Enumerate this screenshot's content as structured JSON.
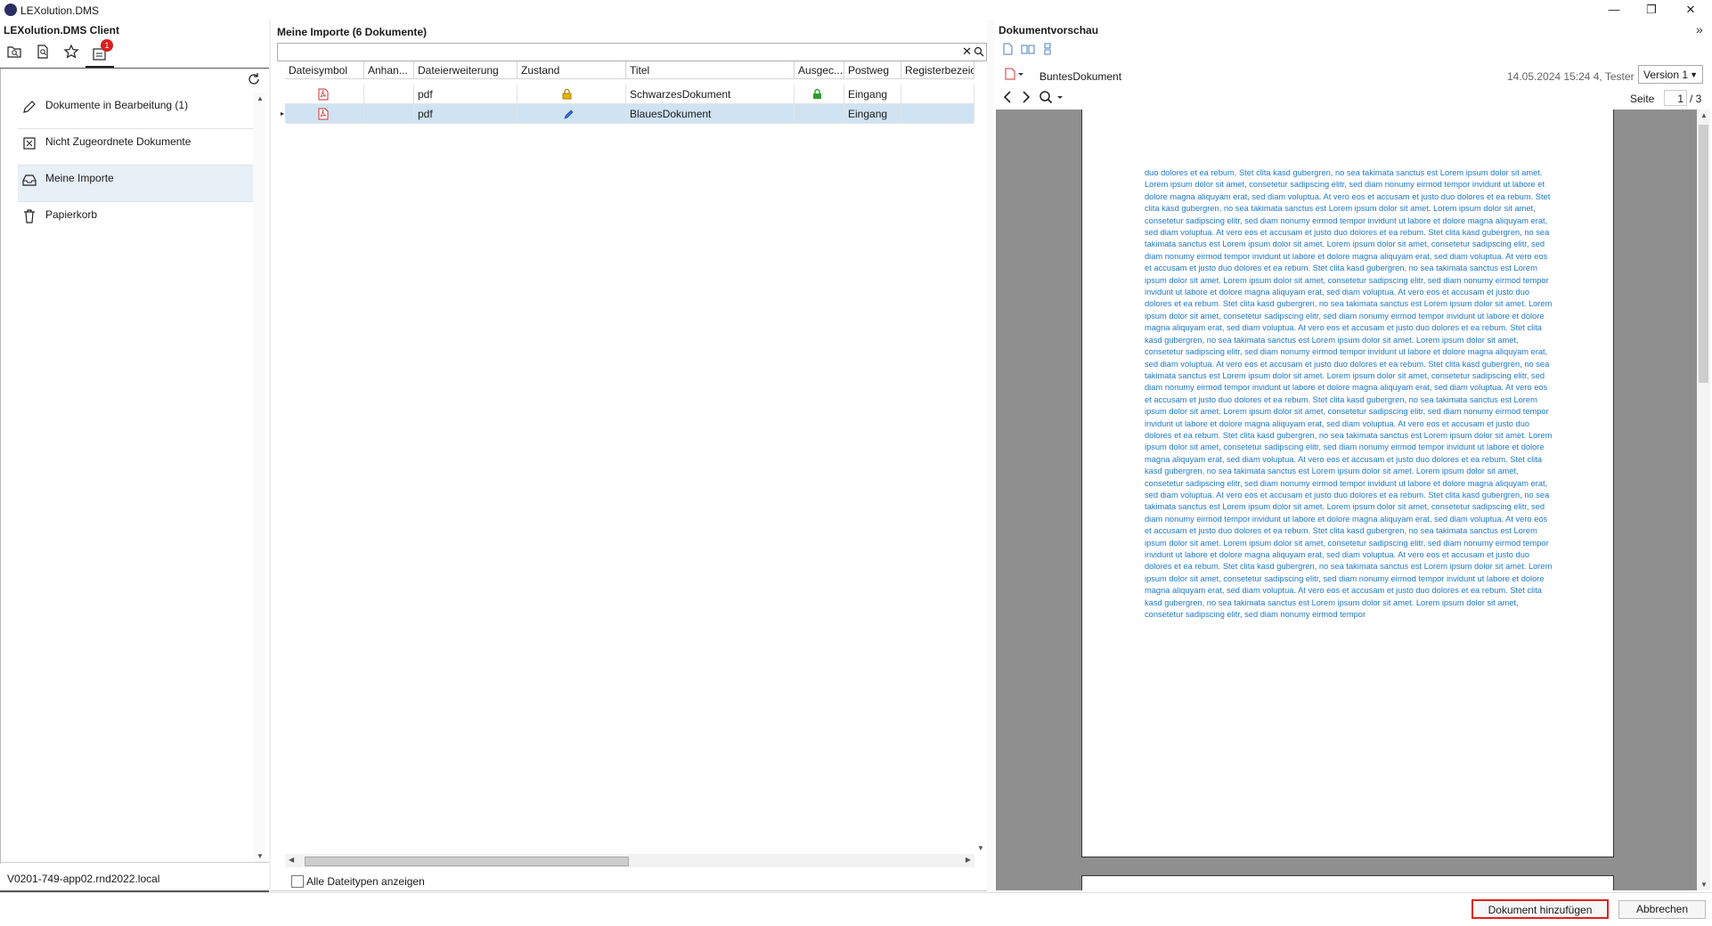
{
  "window": {
    "title": "LEXolution.DMS",
    "minimize": "—",
    "restore": "❐",
    "close": "✕"
  },
  "left": {
    "title": "LEXolution.DMS Client",
    "badge_count": "1",
    "nav": [
      {
        "label": "Dokumente in Bearbeitung (1)",
        "icon": "pencil-icon"
      },
      {
        "label": "Nicht Zugeordnete Dokumente",
        "icon": "unassigned-doc-icon"
      },
      {
        "label": "Meine Importe",
        "icon": "inbox-icon"
      },
      {
        "label": "Papierkorb",
        "icon": "trash-icon"
      }
    ],
    "host": "V0201-749-app02.rnd2022.local"
  },
  "middle": {
    "title": "Meine Importe (6 Dokumente)",
    "search_value": "",
    "columns": [
      "Dateisymbol",
      "Anhan...",
      "Dateierweiterung",
      "Zustand",
      "Titel",
      "Ausgec...",
      "Postweg",
      "Registerbezeichr"
    ],
    "rows": [
      {
        "ext": "pdf",
        "state_icon": "lock-icon",
        "title": "SchwarzesDokument",
        "checked_out_icon": "green-lock-icon",
        "postweg": "Eingang"
      },
      {
        "ext": "pdf",
        "state_icon": "edit-pen-icon",
        "title": "BlauesDokument",
        "checked_out_icon": "",
        "postweg": "Eingang"
      }
    ],
    "checkbox_label": "Alle Dateitypen anzeigen"
  },
  "preview": {
    "title": "Dokumentvorschau",
    "doc_name": "BuntesDokument",
    "meta": "14.05.2024 15:24 4, Tester",
    "version": "Version 1",
    "page_label": "Seite",
    "page_current": "1",
    "page_total": "/ 3",
    "text_color": "#1f78c8",
    "body_text": "duo dolores et ea rebum. Stet clita kasd gubergren, no sea takimata sanctus est Lorem ipsum dolor sit amet. Lorem ipsum dolor sit amet, consetetur sadipscing elitr, sed diam nonumy eirmod tempor invidunt ut labore et dolore magna aliquyam erat, sed diam voluptua. At vero eos et accusam et justo duo dolores et ea rebum. Stet clita kasd gubergren, no sea takimata sanctus est Lorem ipsum dolor sit amet. Lorem ipsum dolor sit amet, consetetur sadipscing elitr, sed diam nonumy eirmod tempor invidunt ut labore et dolore magna aliquyam erat, sed diam voluptua. At vero eos et accusam et justo duo dolores et ea rebum. Stet clita kasd gubergren, no sea takimata sanctus est Lorem ipsum dolor sit amet. Lorem ipsum dolor sit amet, consetetur sadipscing elitr, sed diam nonumy eirmod tempor invidunt ut labore et dolore magna aliquyam erat, sed diam voluptua. At vero eos et accusam et justo duo dolores et ea rebum. Stet clita kasd gubergren, no sea takimata sanctus est Lorem ipsum dolor sit amet. Lorem ipsum dolor sit amet, consetetur sadipscing elitr, sed diam nonumy eirmod tempor invidunt ut labore et dolore magna aliquyam erat, sed diam voluptua. At vero eos et accusam et justo duo dolores et ea rebum. Stet clita kasd gubergren, no sea takimata sanctus est Lorem ipsum dolor sit amet. Lorem ipsum dolor sit amet, consetetur sadipscing elitr, sed diam nonumy eirmod tempor invidunt ut labore et dolore magna aliquyam erat, sed diam voluptua. At vero eos et accusam et justo duo dolores et ea rebum. Stet clita kasd gubergren, no sea takimata sanctus est Lorem ipsum dolor sit amet. Lorem ipsum dolor sit amet, consetetur sadipscing elitr, sed diam nonumy eirmod tempor invidunt ut labore et dolore magna aliquyam erat, sed diam voluptua. At vero eos et accusam et justo duo dolores et ea rebum. Stet clita kasd gubergren, no sea takimata sanctus est Lorem ipsum dolor sit amet. Lorem ipsum dolor sit amet, consetetur sadipscing elitr, sed diam nonumy eirmod tempor invidunt ut labore et dolore magna aliquyam erat, sed diam voluptua. At vero eos et accusam et justo duo dolores et ea rebum. Stet clita kasd gubergren, no sea takimata sanctus est Lorem ipsum dolor sit amet. Lorem ipsum dolor sit amet, consetetur sadipscing elitr, sed diam nonumy eirmod tempor invidunt ut labore et dolore magna aliquyam erat, sed diam voluptua. At vero eos et accusam et justo duo dolores et ea rebum. Stet clita kasd gubergren, no sea takimata sanctus est Lorem ipsum dolor sit amet. Lorem ipsum dolor sit amet, consetetur sadipscing elitr, sed diam nonumy eirmod tempor invidunt ut labore et dolore magna aliquyam erat, sed diam voluptua. At vero eos et accusam et justo duo dolores et ea rebum. Stet clita kasd gubergren, no sea takimata sanctus est Lorem ipsum dolor sit amet. Lorem ipsum dolor sit amet, consetetur sadipscing elitr, sed diam nonumy eirmod tempor invidunt ut labore et dolore magna aliquyam erat, sed diam voluptua. At vero eos et accusam et justo duo dolores et ea rebum. Stet clita kasd gubergren, no sea takimata sanctus est Lorem ipsum dolor sit amet. Lorem ipsum dolor sit amet, consetetur sadipscing elitr, sed diam nonumy eirmod tempor invidunt ut labore et dolore magna aliquyam erat, sed diam voluptua. At vero eos et accusam et justo duo dolores et ea rebum. Stet clita kasd gubergren, no sea takimata sanctus est Lorem ipsum dolor sit amet. Lorem ipsum dolor sit amet, consetetur sadipscing elitr, sed diam nonumy eirmod tempor invidunt ut labore et dolore magna aliquyam erat, sed diam voluptua. At vero eos et accusam et justo duo dolores et ea rebum. Stet clita kasd gubergren, no sea takimata sanctus est Lorem ipsum dolor sit amet. Lorem ipsum dolor sit amet, consetetur sadipscing elitr, sed diam nonumy eirmod tempor invidunt ut labore et dolore magna aliquyam erat, sed diam voluptua. At vero eos et accusam et justo duo dolores et ea rebum. Stet clita kasd gubergren, no sea takimata sanctus est Lorem ipsum dolor sit amet. Lorem ipsum dolor sit amet, consetetur sadipscing elitr, sed diam nonumy eirmod tempor"
  },
  "footer": {
    "add_button": "Dokument hinzufügen",
    "cancel_button": "Abbrechen"
  }
}
